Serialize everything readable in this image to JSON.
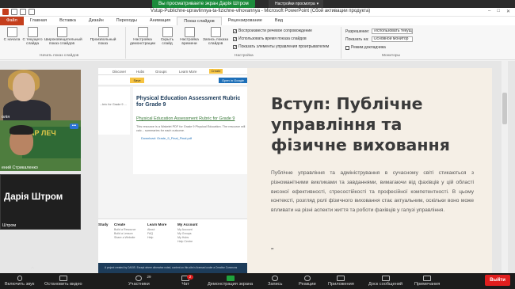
{
  "zoom": {
    "share_banner": "Вы просматриваете экран Дарія Штром",
    "view_options": "Настройки просмотра",
    "view_options_caret": "▾"
  },
  "ppt": {
    "title": "Vstup-Publichne-upravlinnya-ta-fizichne-vihovannya - Microsoft PowerPoint (Сбой активации продукта)",
    "window_controls": [
      "–",
      "□",
      "✕"
    ],
    "tabs": [
      "Файл",
      "Главная",
      "Вставка",
      "Дизайн",
      "Переходы",
      "Анимация",
      "Показ слайдов",
      "Рецензирование",
      "Вид"
    ],
    "ribbon": {
      "buttons": [
        {
          "label": "С начала"
        },
        {
          "label": "С текущего слайда"
        },
        {
          "label": "Широковещательный показ слайдов"
        },
        {
          "label": "Произвольный показ"
        },
        {
          "label": "Настройка демонстрации"
        },
        {
          "label": "Скрыть слайд"
        },
        {
          "label": "Настройка времени"
        },
        {
          "label": "Запись показа слайдов"
        }
      ],
      "group_start": "Начать показ слайдов",
      "group_setup": "Настройка",
      "group_monitors": "Мониторы",
      "checks": [
        {
          "label": "Воспроизвести речевое сопровождение",
          "checked": true
        },
        {
          "label": "Использовать время показа слайдов",
          "checked": true
        },
        {
          "label": "Показать элементы управления проигрывателем",
          "checked": true
        }
      ],
      "resolution_label": "Разрешение:",
      "resolution_value": "Использовать текущ...",
      "show_on_label": "Показать на:",
      "show_on_value": "Основной монитор",
      "presenter_view": "Режим докладчика"
    },
    "slide": {
      "title": "Вступ: Публічне управління та фізичне виховання",
      "body": "Публічне управління та адміністрування в сучасному світі стикаються з різноманітними викликами та завданнями, вимагаючи від фахівців у цій області високої ефективності, стресостійкості та професійної компетентності. В цьому контексті, розгляд ролі фізичного виховання стає актуальним, оскільки воно може впливати на різні аспекти життя та роботи фахівців у галузі управління.",
      "mark": "„",
      "web": {
        "nav": [
          "Discover",
          "Hubs",
          "Groups",
          "Learn More"
        ],
        "create": "Create",
        "save": "Save",
        "open": "Open in Google",
        "rubric_title": "Physical Education Assessment Rubric for Grade 9",
        "rubric_link": "Physical Education Assessment Rubric for Grade 9",
        "rubric_desc": "This resource is a Wakelet PDF for Grade 9 Physical Education. The resource will calc... summaries for each outcome.",
        "download": "Download: Grade_9_Final_Final.pdf",
        "side_snip": "...bric for Grade 9 ...",
        "footer_cols": [
          {
            "title": "Study",
            "items": []
          },
          {
            "title": "Create",
            "items": [
              "Build a Resource",
              "Build a Lesson",
              "Share a Website"
            ]
          },
          {
            "title": "Learn More",
            "items": [
              "About",
              "FAQ",
              "Help"
            ]
          },
          {
            "title": "My Account",
            "items": [
              "My Account",
              "My Groups",
              "My Hubs",
              "Help Centre"
            ]
          }
        ],
        "copy": "A project created by OASIS. Except where otherwise noted, content on this site is licensed under a Creative Commons"
      }
    }
  },
  "gallery": {
    "p1_name": "олія",
    "p2_name": "ений Стрикаленко",
    "p2_banner": "ХАР ЛЕЧ",
    "p2_more": "•••",
    "p3_big": "Дарія Штром",
    "p3_name": "Штром"
  },
  "toolbar": {
    "mic": "Включить звук",
    "video": "Остановить видео",
    "participants": "Участники",
    "participants_count": "29",
    "chat": "Чат",
    "chat_badge": "2",
    "share": "Демонстрация экрана",
    "record": "Запись",
    "reactions": "Реакции",
    "apps": "Приложения",
    "docs": "Доск сообщений",
    "notes": "Примечания",
    "leave": "Выйти",
    "caret": "^"
  }
}
